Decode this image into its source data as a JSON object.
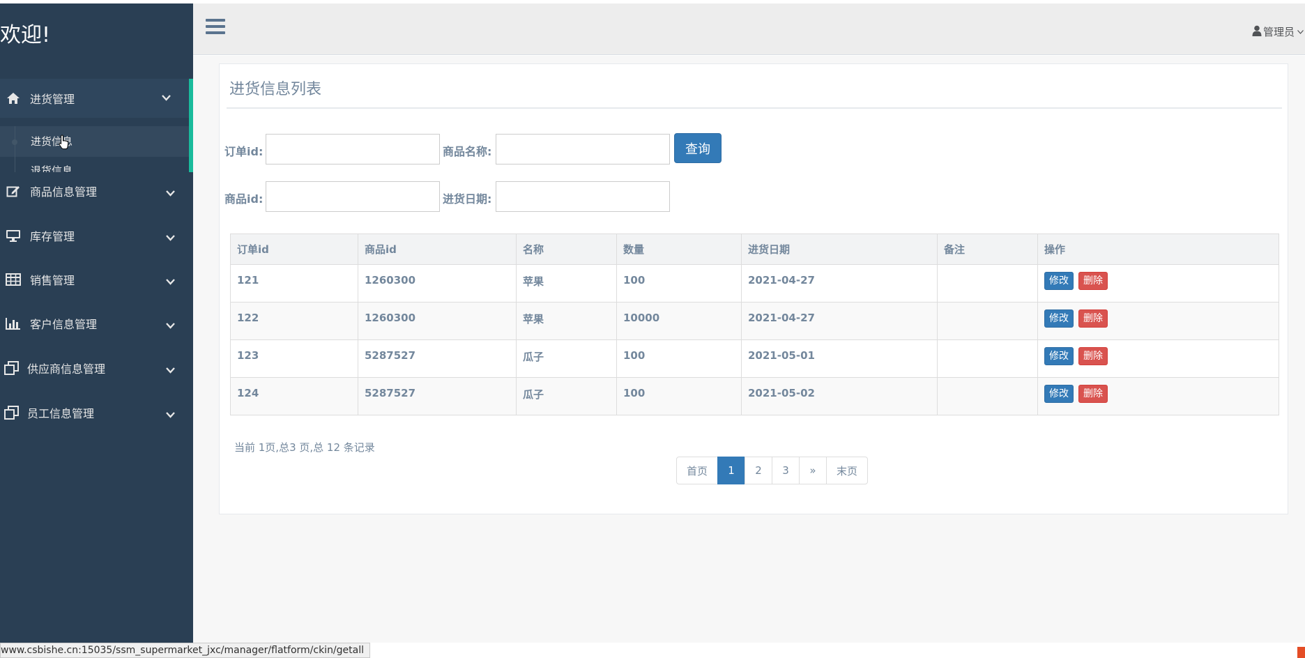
{
  "brand": "欢迎!",
  "sidebar": {
    "items": [
      {
        "label": "进货管理",
        "icon": "home-icon"
      },
      {
        "label": "商品信息管理",
        "icon": "edit-icon"
      },
      {
        "label": "库存管理",
        "icon": "desktop-icon"
      },
      {
        "label": "销售管理",
        "icon": "table-icon"
      },
      {
        "label": "客户信息管理",
        "icon": "bar-chart-icon"
      },
      {
        "label": "供应商信息管理",
        "icon": "clone-icon"
      },
      {
        "label": "员工信息管理",
        "icon": "clone-icon"
      }
    ],
    "submenu": {
      "active": "进货信息",
      "next": "退货信息"
    }
  },
  "topnav": {
    "user": "管理员"
  },
  "panel": {
    "title": "进货信息列表"
  },
  "form": {
    "order_id_label": "订单id:",
    "order_id_value": "",
    "product_name_label": "商品名称:",
    "product_name_value": "",
    "product_id_label": "商品id:",
    "product_id_value": "",
    "date_label": "进货日期:",
    "date_value": "",
    "query_button": "查询"
  },
  "table": {
    "headers": [
      "订单id",
      "商品id",
      "名称",
      "数量",
      "进货日期",
      "备注",
      "操作"
    ],
    "rows": [
      {
        "order_id": "121",
        "product_id": "1260300",
        "name": "苹果",
        "qty": "100",
        "date": "2021-04-27",
        "note": ""
      },
      {
        "order_id": "122",
        "product_id": "1260300",
        "name": "苹果",
        "qty": "10000",
        "date": "2021-04-27",
        "note": ""
      },
      {
        "order_id": "123",
        "product_id": "5287527",
        "name": "瓜子",
        "qty": "100",
        "date": "2021-05-01",
        "note": ""
      },
      {
        "order_id": "124",
        "product_id": "5287527",
        "name": "瓜子",
        "qty": "100",
        "date": "2021-05-02",
        "note": ""
      }
    ],
    "edit_label": "修改",
    "delete_label": "删除"
  },
  "pagination": {
    "info": "当前 1页,总3 页,总 12 条记录",
    "first": "首页",
    "pages": [
      "1",
      "2",
      "3"
    ],
    "current": "1",
    "next": "»",
    "last": "末页"
  },
  "statusbar": {
    "url": "www.csbishe.cn:15035/ssm_supermarket_jxc/manager/flatform/ckin/getall"
  },
  "colors": {
    "sidebar_bg": "#2a3f54",
    "accent_green": "#1ABB9C",
    "primary": "#337ab7",
    "danger": "#d9534f"
  }
}
